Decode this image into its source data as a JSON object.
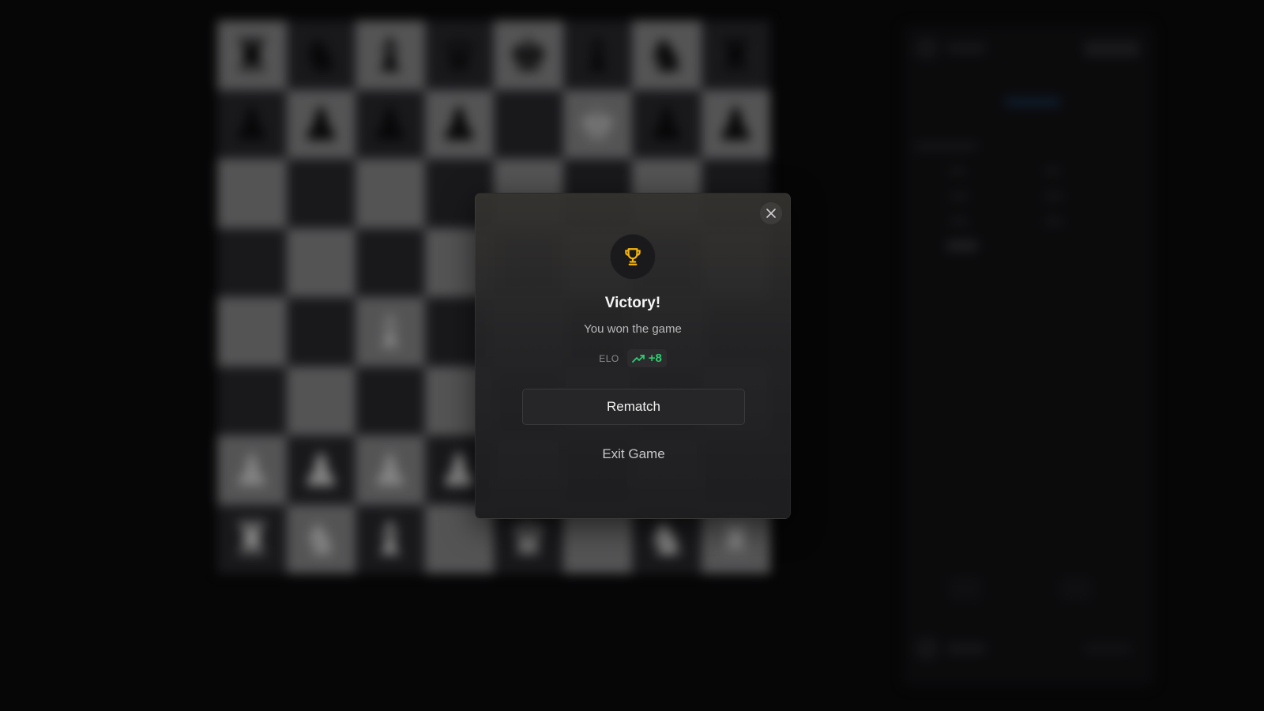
{
  "modal": {
    "title": "Victory!",
    "subtitle": "You won the game",
    "elo_label": "ELO",
    "elo_change": "+8",
    "rematch_label": "Rematch",
    "exit_label": "Exit Game",
    "trophy_icon": "trophy-icon",
    "close_icon": "close-icon",
    "trend_icon": "trending-up-icon"
  },
  "colors": {
    "accent_gold": "#f5b50a",
    "positive_green": "#2ecc71",
    "modal_bg": "#252527"
  },
  "board": {
    "ranks": [
      [
        "bR",
        "bN",
        "bB",
        "bQ",
        "bK",
        "bB",
        "bN",
        "bR"
      ],
      [
        "bP",
        "bP",
        "bP",
        "bP",
        "",
        "wK",
        "bP",
        "bP"
      ],
      [
        "",
        "",
        "",
        "",
        "",
        "",
        "",
        ""
      ],
      [
        "",
        "",
        "",
        "",
        "",
        "",
        "",
        ""
      ],
      [
        "",
        "",
        "wB",
        "",
        "",
        "",
        "",
        ""
      ],
      [
        "",
        "",
        "",
        "",
        "",
        "",
        "",
        ""
      ],
      [
        "wP",
        "wP",
        "wP",
        "wP",
        "",
        "",
        "",
        ""
      ],
      [
        "wR",
        "wN",
        "wB",
        "",
        "wQ",
        "",
        "wN",
        "wR"
      ]
    ]
  }
}
